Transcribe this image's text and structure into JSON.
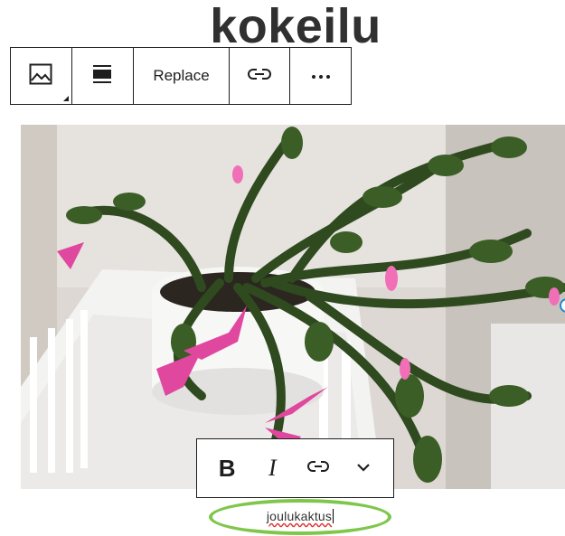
{
  "page": {
    "title": "kokeilu"
  },
  "block_toolbar": {
    "items": [
      {
        "icon": "image-icon"
      },
      {
        "icon": "align-icon"
      },
      {
        "label": "Replace"
      },
      {
        "icon": "link-icon"
      },
      {
        "icon": "more-options-icon"
      }
    ]
  },
  "image": {
    "subject": "christmas cactus with pink flowers in a white pot"
  },
  "format_toolbar": {
    "bold_label": "B",
    "italic_label": "I",
    "items": [
      {
        "icon": "link-icon"
      },
      {
        "icon": "chevron-down-icon"
      }
    ]
  },
  "caption": {
    "value": "joulukaktus",
    "highlight_color": "#7ec74a"
  }
}
